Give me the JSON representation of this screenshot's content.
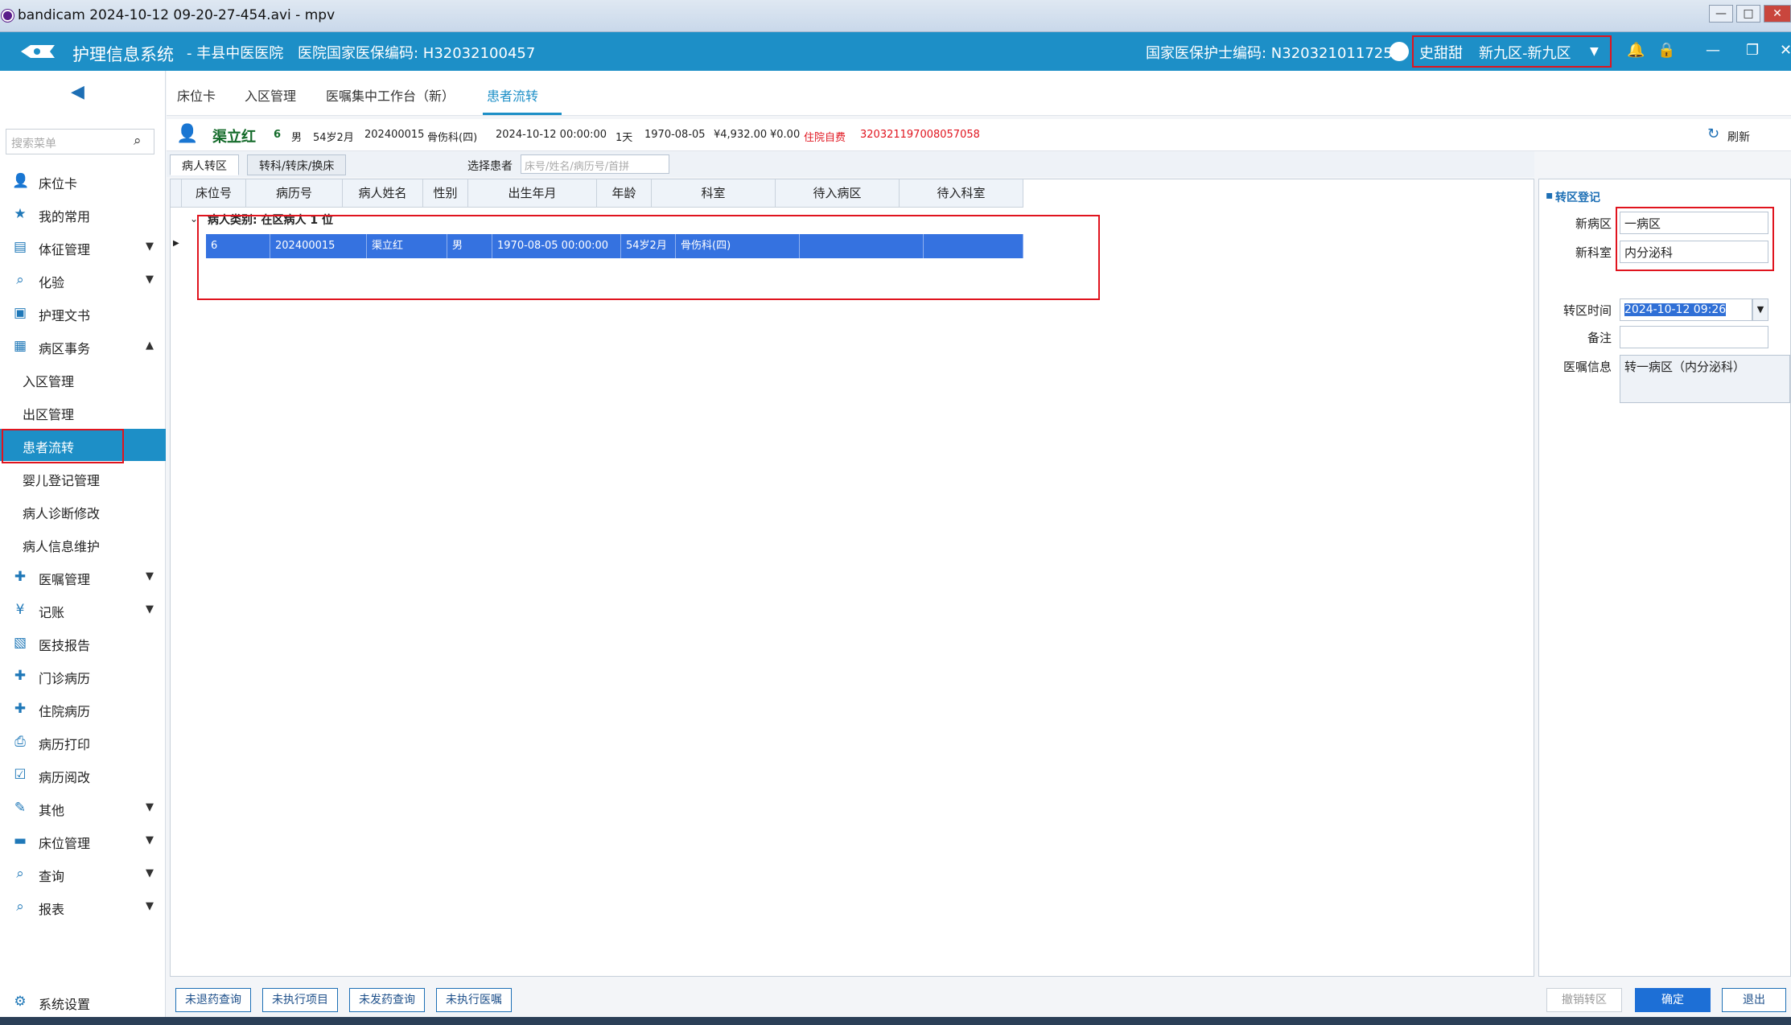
{
  "window": {
    "title": "bandicam 2024-10-12 09-20-27-454.avi - mpv"
  },
  "app": {
    "name": "护理信息系统",
    "hospital": "- 丰县中医医院",
    "insurance_code": "医院国家医保编码: H32032100457",
    "nurse_code": "国家医保护士编码: N320321011725",
    "user": "史甜甜",
    "ward": "新九区-新九区"
  },
  "sidebar": {
    "search_placeholder": "搜索菜单",
    "items": [
      {
        "label": "床位卡",
        "icon": "user-bed-icon"
      },
      {
        "label": "我的常用",
        "icon": "star-icon"
      },
      {
        "label": "体征管理",
        "icon": "chart-icon"
      },
      {
        "label": "化验",
        "icon": "search-icon"
      },
      {
        "label": "护理文书",
        "icon": "doc-icon"
      },
      {
        "label": "病区事务",
        "icon": "ward-icon"
      },
      {
        "label": "入区管理"
      },
      {
        "label": "出区管理"
      },
      {
        "label": "患者流转"
      },
      {
        "label": "婴儿登记管理"
      },
      {
        "label": "病人诊断修改"
      },
      {
        "label": "病人信息维护"
      },
      {
        "label": "医嘱管理",
        "icon": "plus-icon"
      },
      {
        "label": "记账",
        "icon": "yen-icon"
      },
      {
        "label": "医技报告",
        "icon": "report-icon"
      },
      {
        "label": "门诊病历",
        "icon": "clinic-icon"
      },
      {
        "label": "住院病历",
        "icon": "inpatient-icon"
      },
      {
        "label": "病历打印",
        "icon": "print-icon"
      },
      {
        "label": "病历阅改",
        "icon": "check-icon"
      },
      {
        "label": "其他",
        "icon": "edit-icon"
      },
      {
        "label": "床位管理",
        "icon": "bed-icon"
      },
      {
        "label": "查询",
        "icon": "search-icon"
      },
      {
        "label": "报表",
        "icon": "search-icon"
      }
    ],
    "settings": "系统设置"
  },
  "tabs": [
    "床位卡",
    "入区管理",
    "医嘱集中工作台（新）",
    "患者流转"
  ],
  "patient": {
    "name": "渠立红",
    "bed": "6",
    "sex": "男",
    "age": "54岁2月",
    "record_no": "202400015",
    "dept": "骨伤科(四)",
    "admit_time": "2024-10-12 00:00:00",
    "days": "1天",
    "birth": "1970-08-05",
    "balance": "¥4,932.00",
    "owed": "¥0.00",
    "pay_type": "住院自费",
    "id_no": "320321197008057058",
    "refresh": "刷新"
  },
  "subtabs": [
    "病人转区",
    "转科/转床/换床"
  ],
  "select_patient": {
    "label": "选择患者",
    "placeholder": "床号/姓名/病历号/首拼"
  },
  "grid": {
    "headers": [
      "床位号",
      "病历号",
      "病人姓名",
      "性别",
      "出生年月",
      "年龄",
      "科室",
      "待入病区",
      "待入科室"
    ],
    "group": "病人类别: 在区病人  1 位",
    "rows": [
      [
        "6",
        "202400015",
        "渠立红",
        "男",
        "1970-08-05 00:00:00",
        "54岁2月",
        "骨伤科(四)",
        "",
        ""
      ]
    ]
  },
  "transfer": {
    "title": "转区登记",
    "new_ward_label": "新病区",
    "new_ward": "一病区",
    "new_dept_label": "新科室",
    "new_dept": "内分泌科",
    "time_label": "转区时间",
    "time": "2024-10-12 09:26",
    "remark_label": "备注",
    "remark": "",
    "order_label": "医嘱信息",
    "order": "转一病区（内分泌科）"
  },
  "bottom": {
    "buttons": [
      "未退药查询",
      "未执行项目",
      "未发药查询",
      "未执行医嘱"
    ],
    "cancel": "撤销转区",
    "confirm": "确定",
    "exit": "退出"
  }
}
